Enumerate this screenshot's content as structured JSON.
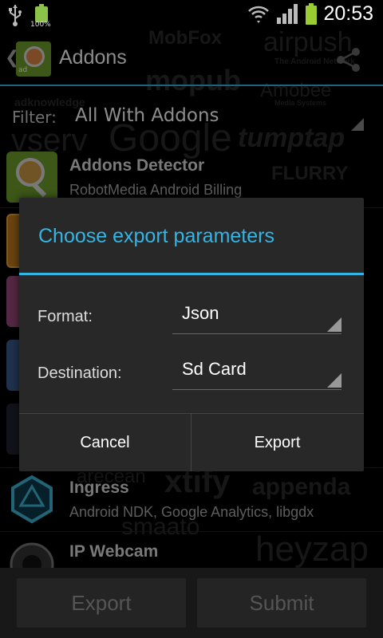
{
  "status_bar": {
    "time": "20:53",
    "battery_percent": "100%"
  },
  "action_bar": {
    "title": "Addons"
  },
  "filter": {
    "label": "Filter:",
    "value": "All With Addons"
  },
  "background_logos": [
    "MobFox",
    "airpush",
    "The Android Network",
    "mopub",
    "Amobee",
    "Media Systems",
    "adknowledge",
    "vserv",
    "Google",
    "tumptap",
    "FLURRY",
    "arecean",
    "xtify",
    "appenda",
    "smaato",
    "heyzap"
  ],
  "list_items": [
    {
      "title": "Addons Detector",
      "subtitle": "RobotMedia Android Billing",
      "icon": "addons-detector-icon"
    },
    {
      "title": "",
      "subtitle": "",
      "icon": "app-icon-orange"
    },
    {
      "title": "",
      "subtitle": "",
      "icon": "app-icon-pink"
    },
    {
      "title": "",
      "subtitle": "",
      "icon": "app-icon-blue"
    },
    {
      "title": "",
      "subtitle": "",
      "icon": "app-icon-dark"
    },
    {
      "title": "Ingress",
      "subtitle": "Android NDK, Google Analytics, libgdx",
      "icon": "ingress-icon"
    },
    {
      "title": "IP Webcam",
      "subtitle": "",
      "icon": "webcam-icon"
    }
  ],
  "dialog": {
    "title": "Choose export parameters",
    "format_label": "Format:",
    "format_value": "Json",
    "destination_label": "Destination:",
    "destination_value": "Sd Card",
    "cancel": "Cancel",
    "export": "Export"
  },
  "bottom_bar": {
    "export": "Export",
    "submit": "Submit"
  },
  "colors": {
    "accent": "#33b5e5",
    "background": "#000000",
    "dialog": "#282828"
  }
}
